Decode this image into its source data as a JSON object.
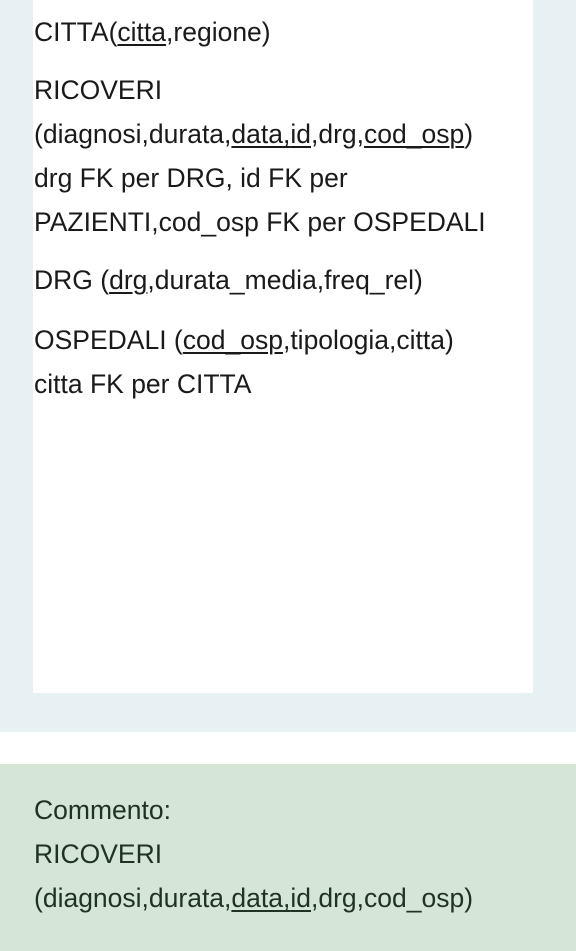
{
  "answer": {
    "citta": {
      "name": "CITTA(",
      "key": "citta",
      "rest": ",regione)"
    },
    "ricoveri": {
      "name": "RICOVERI",
      "open": "(diagnosi,durata,",
      "key1": "data",
      "comma": ",",
      "key2": "id",
      "mid": ",drg,",
      "key3": "cod_osp",
      "close": ")",
      "fk_line1": "drg FK per DRG, id FK per",
      "fk_line2": "PAZIENTI,cod_osp FK per OSPEDALI"
    },
    "drg": {
      "prefix": "DRG (",
      "key": "drg",
      "rest": ",durata_media,freq_rel)"
    },
    "ospedali": {
      "prefix": "OSPEDALI (",
      "key": "cod_osp",
      "rest": ",tipologia,citta)",
      "fk_line": "citta FK per CITTA"
    }
  },
  "comment": {
    "label": "Commento:",
    "name": "RICOVERI",
    "open": "(diagnosi,durata,",
    "key1": "data",
    "comma": ",",
    "key2": "id",
    "rest": ",drg,cod_osp)"
  }
}
